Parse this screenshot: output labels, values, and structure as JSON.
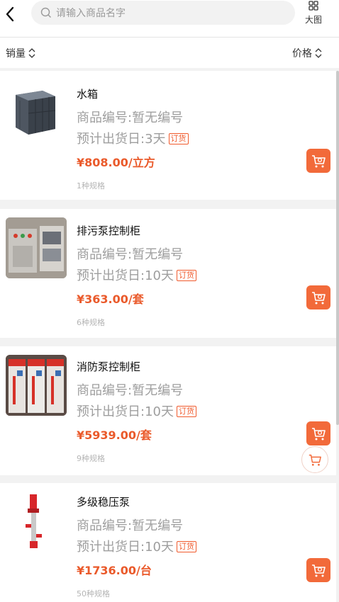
{
  "search": {
    "placeholder": "请输入商品名字"
  },
  "header": {
    "bigview_label": "大图"
  },
  "sort": {
    "sales_label": "销量",
    "price_label": "价格"
  },
  "colors": {
    "accent": "#f26a3a",
    "price": "#ea5a2b"
  },
  "products": [
    {
      "name": "水箱",
      "code": "商品编号:暂无编号",
      "ship": "预计出货日:3天",
      "tag": "订货",
      "price": "¥808.00/立方",
      "specs": "1种规格"
    },
    {
      "name": "排污泵控制柜",
      "code": "商品编号:暂无编号",
      "ship": "预计出货日:10天",
      "tag": "订货",
      "price": "¥363.00/套",
      "specs": "6种规格"
    },
    {
      "name": "消防泵控制柜",
      "code": "商品编号:暂无编号",
      "ship": "预计出货日:10天",
      "tag": "订货",
      "price": "¥5939.00/套",
      "specs": "9种规格"
    },
    {
      "name": "多级稳压泵",
      "code": "商品编号:暂无编号",
      "ship": "预计出货日:10天",
      "tag": "订货",
      "price": "¥1736.00/台",
      "specs": "50种规格"
    }
  ]
}
